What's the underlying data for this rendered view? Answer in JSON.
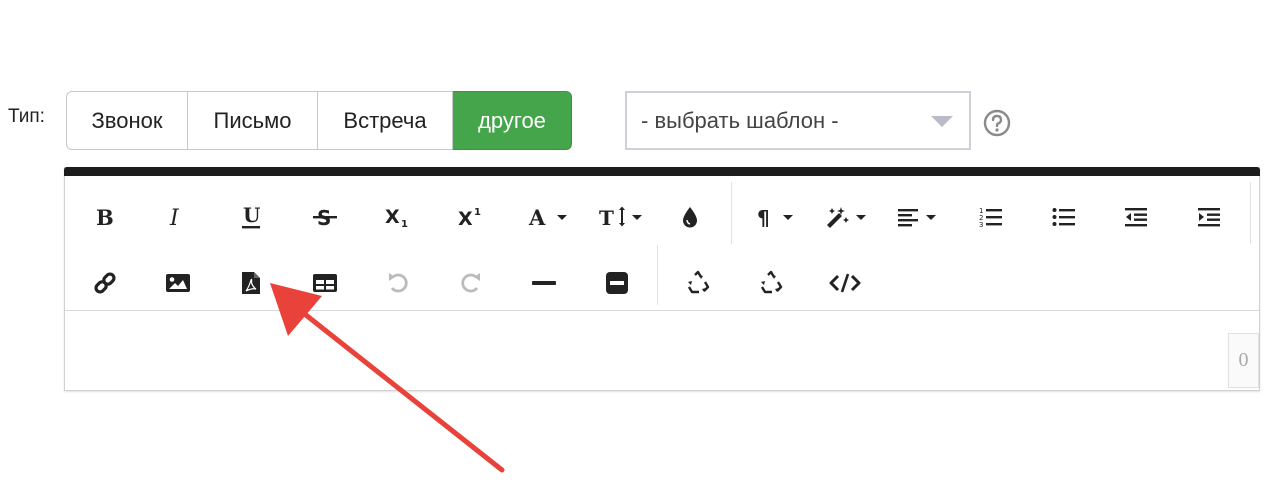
{
  "form": {
    "type_label": "Тип:",
    "type_options": [
      {
        "label": "Звонок",
        "active": false
      },
      {
        "label": "Письмо",
        "active": false
      },
      {
        "label": "Встреча",
        "active": false
      },
      {
        "label": "другое",
        "active": true
      }
    ],
    "template_select": {
      "selected": "- выбрать шаблон -"
    }
  },
  "editor": {
    "accent_bar_color": "#1c1c1c",
    "toolbar_row1": [
      "bold-icon",
      "italic-icon",
      "underline-icon",
      "strikethrough-icon",
      "subscript-icon",
      "superscript-icon",
      "font-color-dropdown",
      "font-size-dropdown",
      "highlight-color-icon",
      "paragraph-dropdown",
      "magic-style-dropdown",
      "align-dropdown",
      "ordered-list-icon",
      "unordered-list-icon",
      "outdent-icon",
      "indent-icon"
    ],
    "toolbar_row2": [
      "link-icon",
      "image-icon",
      "pdf-file-icon",
      "table-icon",
      "undo-icon",
      "redo-icon",
      "horizontal-rule-icon",
      "remove-format-icon",
      "recycle-icon",
      "recycle-alt-icon",
      "code-view-icon"
    ],
    "char_count": "0"
  },
  "colors": {
    "active_button": "#45a54a",
    "arrow": "#e8423a"
  }
}
